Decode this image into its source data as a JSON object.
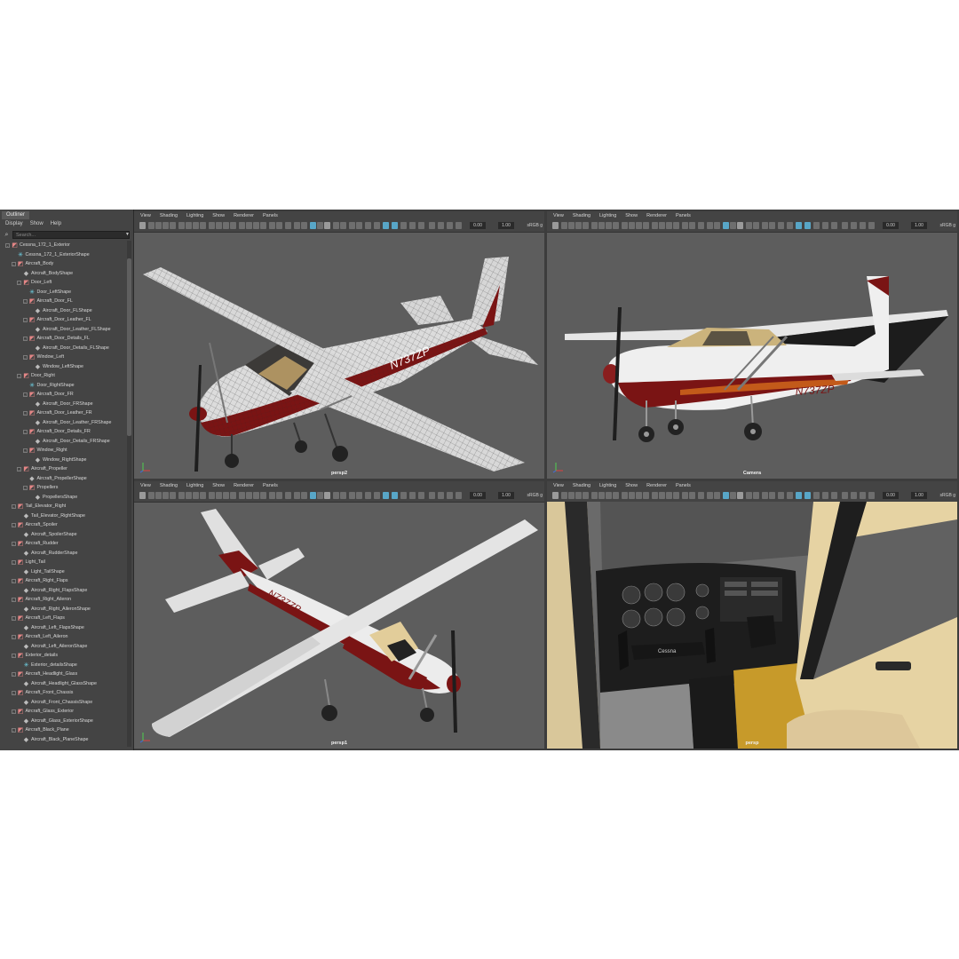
{
  "outliner": {
    "tab": "Outliner",
    "menu": [
      "Display",
      "Show",
      "Help"
    ],
    "search_placeholder": "Search...",
    "items": [
      {
        "label": "Cessna_172_1_Exterior",
        "depth": 0,
        "icon": "transform",
        "expand": "-"
      },
      {
        "label": "Cessna_172_1_ExteriorShape",
        "depth": 1,
        "icon": "locator"
      },
      {
        "label": "Aircraft_Body",
        "depth": 1,
        "icon": "transform",
        "expand": "-"
      },
      {
        "label": "Aircraft_BodyShape",
        "depth": 2,
        "icon": "mesh"
      },
      {
        "label": "Door_Left",
        "depth": 2,
        "icon": "transform",
        "expand": "-"
      },
      {
        "label": "Door_LeftShape",
        "depth": 3,
        "icon": "locator"
      },
      {
        "label": "Aircraft_Door_FL",
        "depth": 3,
        "icon": "transform",
        "expand": "-"
      },
      {
        "label": "Aircraft_Door_FLShape",
        "depth": 4,
        "icon": "mesh"
      },
      {
        "label": "Aircraft_Door_Leather_FL",
        "depth": 3,
        "icon": "transform",
        "expand": "-"
      },
      {
        "label": "Aircraft_Door_Leather_FLShape",
        "depth": 4,
        "icon": "mesh"
      },
      {
        "label": "Aircraft_Door_Details_FL",
        "depth": 3,
        "icon": "transform",
        "expand": "-"
      },
      {
        "label": "Aircraft_Door_Details_FLShape",
        "depth": 4,
        "icon": "mesh"
      },
      {
        "label": "Window_Left",
        "depth": 3,
        "icon": "transform",
        "expand": "-"
      },
      {
        "label": "Window_LeftShape",
        "depth": 4,
        "icon": "mesh"
      },
      {
        "label": "Door_Right",
        "depth": 2,
        "icon": "transform",
        "expand": "-"
      },
      {
        "label": "Door_RightShape",
        "depth": 3,
        "icon": "locator"
      },
      {
        "label": "Aircraft_Door_FR",
        "depth": 3,
        "icon": "transform",
        "expand": "-"
      },
      {
        "label": "Aircraft_Door_FRShape",
        "depth": 4,
        "icon": "mesh"
      },
      {
        "label": "Aircraft_Door_Leather_FR",
        "depth": 3,
        "icon": "transform",
        "expand": "-"
      },
      {
        "label": "Aircraft_Door_Leather_FRShape",
        "depth": 4,
        "icon": "mesh"
      },
      {
        "label": "Aircraft_Door_Details_FR",
        "depth": 3,
        "icon": "transform",
        "expand": "-"
      },
      {
        "label": "Aircraft_Door_Details_FRShape",
        "depth": 4,
        "icon": "mesh"
      },
      {
        "label": "Window_Right",
        "depth": 3,
        "icon": "transform",
        "expand": "-"
      },
      {
        "label": "Window_RightShape",
        "depth": 4,
        "icon": "mesh"
      },
      {
        "label": "Aircraft_Propeller",
        "depth": 2,
        "icon": "transform",
        "expand": "-"
      },
      {
        "label": "Aircraft_PropellerShape",
        "depth": 3,
        "icon": "mesh"
      },
      {
        "label": "Propellers",
        "depth": 3,
        "icon": "transform",
        "expand": "-"
      },
      {
        "label": "PropellersShape",
        "depth": 4,
        "icon": "mesh"
      },
      {
        "label": "Tail_Elevator_Right",
        "depth": 1,
        "icon": "transform",
        "expand": "-"
      },
      {
        "label": "Tail_Elevator_RightShape",
        "depth": 2,
        "icon": "mesh"
      },
      {
        "label": "Aircraft_Spoiler",
        "depth": 1,
        "icon": "transform",
        "expand": "-"
      },
      {
        "label": "Aircraft_SpoilerShape",
        "depth": 2,
        "icon": "mesh"
      },
      {
        "label": "Aircraft_Rudder",
        "depth": 1,
        "icon": "transform",
        "expand": "-"
      },
      {
        "label": "Aircraft_RudderShape",
        "depth": 2,
        "icon": "mesh"
      },
      {
        "label": "Light_Tail",
        "depth": 1,
        "icon": "transform",
        "expand": "-"
      },
      {
        "label": "Light_TailShape",
        "depth": 2,
        "icon": "mesh"
      },
      {
        "label": "Aircraft_Right_Flaps",
        "depth": 1,
        "icon": "transform",
        "expand": "-"
      },
      {
        "label": "Aircraft_Right_FlapsShape",
        "depth": 2,
        "icon": "mesh"
      },
      {
        "label": "Aircraft_Right_Aileron",
        "depth": 1,
        "icon": "transform",
        "expand": "-"
      },
      {
        "label": "Aircraft_Right_AileronShape",
        "depth": 2,
        "icon": "mesh"
      },
      {
        "label": "Aircraft_Left_Flaps",
        "depth": 1,
        "icon": "transform",
        "expand": "-"
      },
      {
        "label": "Aircraft_Left_FlapsShape",
        "depth": 2,
        "icon": "mesh"
      },
      {
        "label": "Aircraft_Left_Aileron",
        "depth": 1,
        "icon": "transform",
        "expand": "-"
      },
      {
        "label": "Aircraft_Left_AileronShape",
        "depth": 2,
        "icon": "mesh"
      },
      {
        "label": "Exterior_details",
        "depth": 1,
        "icon": "transform",
        "expand": "-"
      },
      {
        "label": "Exterior_detailsShape",
        "depth": 2,
        "icon": "locator"
      },
      {
        "label": "Aircraft_Headlight_Glass",
        "depth": 1,
        "icon": "transform",
        "expand": "-"
      },
      {
        "label": "Aircraft_Headlight_GlassShape",
        "depth": 2,
        "icon": "mesh"
      },
      {
        "label": "Aircraft_Front_Chassis",
        "depth": 1,
        "icon": "transform",
        "expand": "-"
      },
      {
        "label": "Aircraft_Front_ChassisShape",
        "depth": 2,
        "icon": "mesh"
      },
      {
        "label": "Aircraft_Glass_Exterior",
        "depth": 1,
        "icon": "transform",
        "expand": "-"
      },
      {
        "label": "Aircraft_Glass_ExteriorShape",
        "depth": 2,
        "icon": "mesh"
      },
      {
        "label": "Aircraft_Black_Plane",
        "depth": 1,
        "icon": "transform",
        "expand": "-"
      },
      {
        "label": "Aircraft_Black_PlaneShape",
        "depth": 2,
        "icon": "mesh"
      }
    ]
  },
  "viewport_menu": [
    "View",
    "Shading",
    "Lighting",
    "Show",
    "Renderer",
    "Panels"
  ],
  "toolbar": {
    "field_a": "0.00",
    "field_b": "1.00",
    "colorspace": "sRGB g"
  },
  "viewports": [
    {
      "camera": "persp2",
      "mode": "wireframe"
    },
    {
      "camera": "Camera",
      "mode": "side"
    },
    {
      "camera": "persp1",
      "mode": "top"
    },
    {
      "camera": "persp",
      "mode": "cockpit"
    }
  ],
  "aircraft": {
    "registration": "N737ZP"
  },
  "cockpit": {
    "yoke_brand": "Cessna"
  },
  "colors": {
    "accent": "#58a6c7",
    "livery_red": "#7a1414",
    "fuselage": "#e8e8e8",
    "interior": "#e6d3a3"
  }
}
